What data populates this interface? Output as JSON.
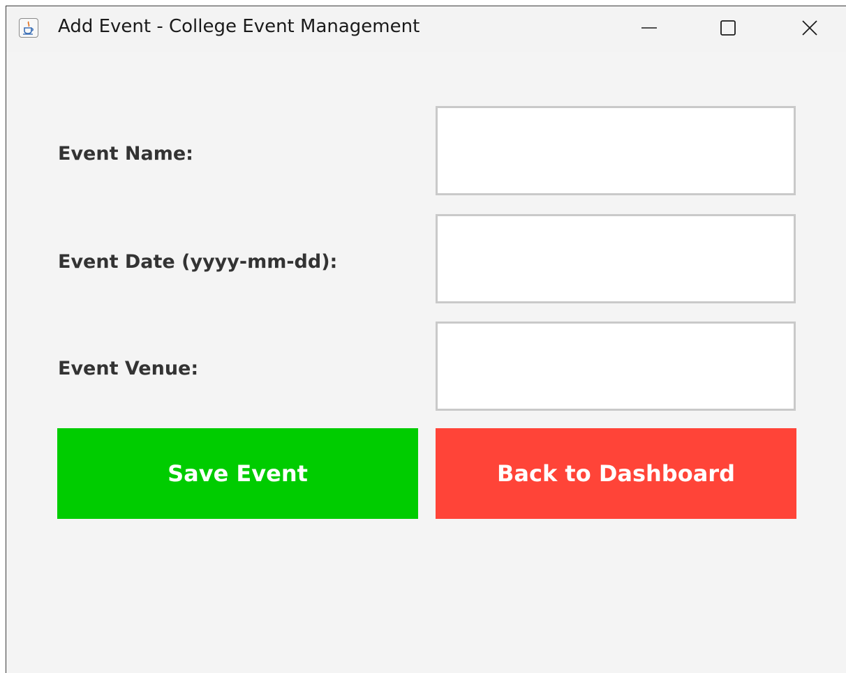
{
  "window": {
    "title": "Add Event - College Event Management",
    "app_icon": "java-cup-icon",
    "controls": [
      "minimize-icon",
      "maximize-icon",
      "close-icon"
    ]
  },
  "form": {
    "fields": [
      {
        "label": "Event Name:",
        "value": ""
      },
      {
        "label": "Event Date (yyyy-mm-dd):",
        "value": ""
      },
      {
        "label": "Event Venue:",
        "value": ""
      }
    ]
  },
  "actions": {
    "save_label": "Save Event",
    "back_label": "Back to Dashboard"
  },
  "colors": {
    "save_button": "#00cc00",
    "back_button": "#ff4438",
    "background": "#f4f4f4"
  }
}
